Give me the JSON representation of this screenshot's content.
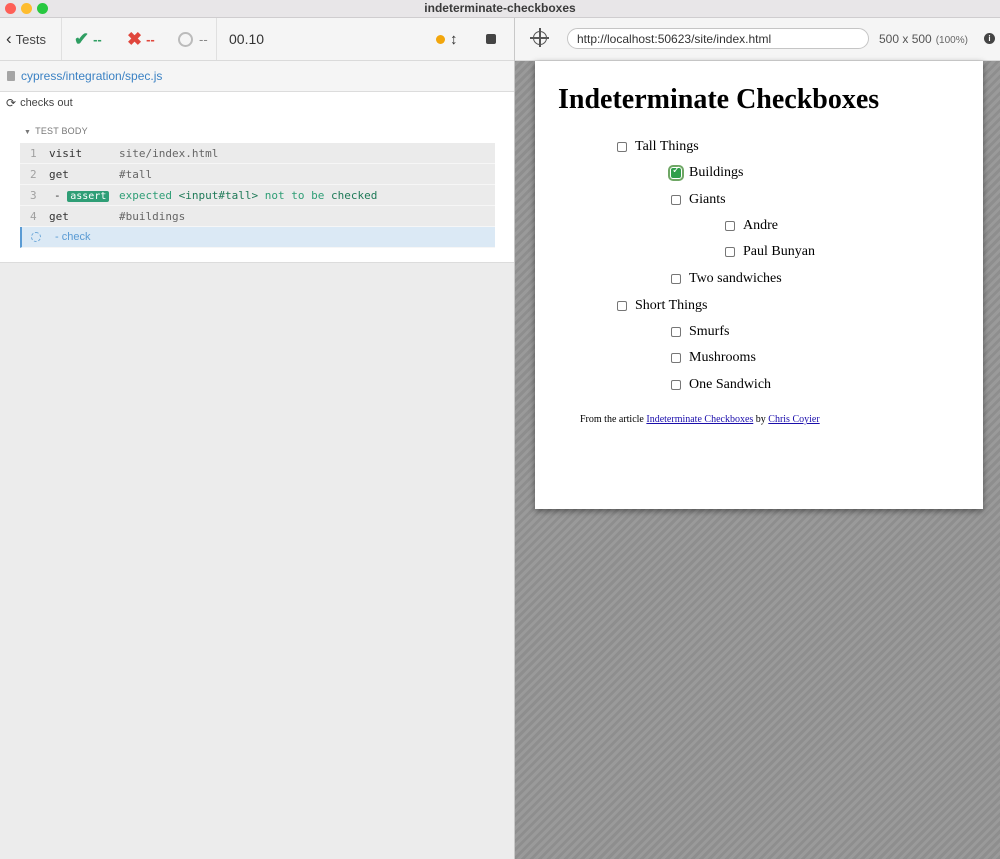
{
  "window": {
    "title": "indeterminate-checkboxes"
  },
  "toolbar": {
    "tests_label": "Tests",
    "passed": "--",
    "failed": "--",
    "pending": "--",
    "duration": "00.10"
  },
  "spec": {
    "path": "cypress/integration/spec.js"
  },
  "test": {
    "title": "checks out",
    "section": "TEST BODY",
    "commands": [
      {
        "num": "1",
        "name": "visit",
        "message": "site/index.html"
      },
      {
        "num": "2",
        "name": "get",
        "message": "#tall"
      },
      {
        "num": "3",
        "name": "assert",
        "message_pre": "expected",
        "subject": "<input#tall>",
        "message_mid": "not to be",
        "message_end": "checked"
      },
      {
        "num": "4",
        "name": "get",
        "message": "#buildings"
      },
      {
        "num": "",
        "name": "- check",
        "message": ""
      }
    ]
  },
  "aut": {
    "url": "http://localhost:50623/site/index.html",
    "viewport": "500 x 500",
    "zoom": "(100%)"
  },
  "page": {
    "heading": "Indeterminate Checkboxes",
    "items": [
      {
        "label": "Tall Things",
        "checked": false
      },
      {
        "label": "Buildings",
        "checked": true
      },
      {
        "label": "Giants",
        "checked": false
      },
      {
        "label": "Andre",
        "checked": false
      },
      {
        "label": "Paul Bunyan",
        "checked": false
      },
      {
        "label": "Two sandwiches",
        "checked": false
      },
      {
        "label": "Short Things",
        "checked": false
      },
      {
        "label": "Smurfs",
        "checked": false
      },
      {
        "label": "Mushrooms",
        "checked": false
      },
      {
        "label": "One Sandwich",
        "checked": false
      }
    ],
    "footer": {
      "prefix": "From the article",
      "article_link": "Indeterminate Checkboxes",
      "by": "by",
      "author_link": "Chris Coyier"
    }
  },
  "colors": {
    "pass": "#2e9e62",
    "fail": "#e0463c",
    "running": "#f2a60c",
    "link": "#3b82c4"
  }
}
